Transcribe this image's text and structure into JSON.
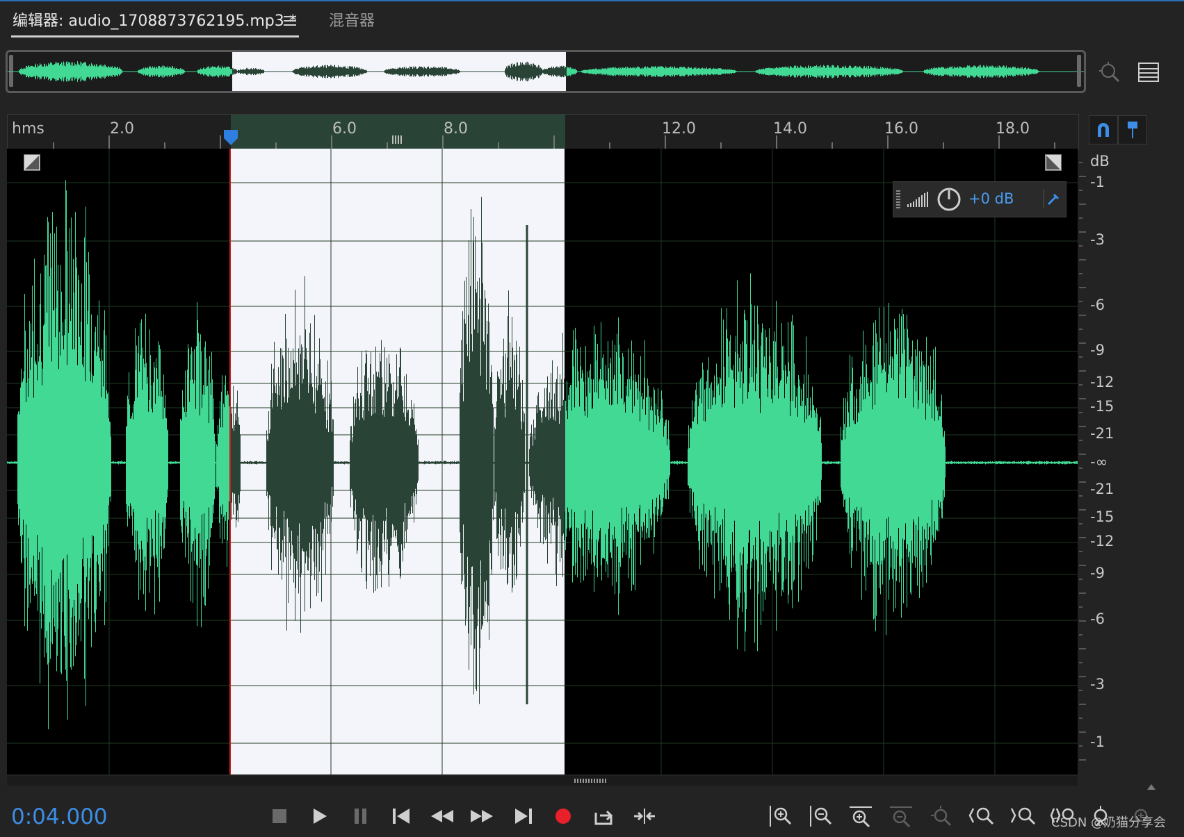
{
  "tabs": {
    "editor_label": "编辑器: audio_1708873762195.mp3 *",
    "mixer_label": "混音器"
  },
  "ruler": {
    "unit": "hms",
    "ticks": [
      "2.0",
      "6.0",
      "8.0",
      "12.0",
      "14.0",
      "16.0",
      "18.0"
    ]
  },
  "amplitude": {
    "value": "+0 dB"
  },
  "db_scale": {
    "labels": [
      "dB",
      "-1",
      "-3",
      "-6",
      "-9",
      "-12",
      "-15",
      "-21",
      "-∞",
      "-21",
      "-15",
      "-12",
      "-9",
      "-6",
      "-3",
      "-1"
    ]
  },
  "transport": {
    "timecode": "0:04.000"
  },
  "watermark": "CSDN @奶猫分享会",
  "colors": {
    "waveform": "#42d995",
    "waveform_selected": "#294437",
    "selection_bg": "#f4f5fa",
    "playhead": "#c81f1f",
    "accent": "#3c8ee6",
    "record": "#e8202a"
  }
}
